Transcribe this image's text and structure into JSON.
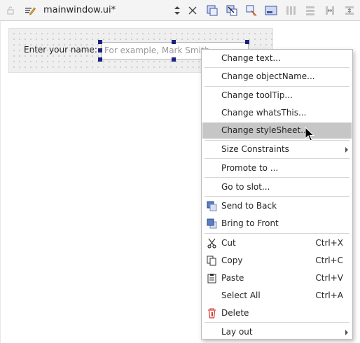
{
  "toolbar": {
    "document_title": "mainwindow.ui*",
    "icons": [
      "lock-icon",
      "edit-document-icon",
      "updown-icon",
      "close-icon",
      "edit-widgets-icon",
      "edit-signals-slots-icon",
      "edit-buddies-icon",
      "edit-tab-order-icon",
      "layout-horizontal-icon",
      "layout-vertical-icon",
      "layout-split-horizontal-icon",
      "layout-split-vertical-icon"
    ]
  },
  "form": {
    "label_text": "Enter your name:",
    "line_edit_placeholder": "For example, Mark Smith"
  },
  "context_menu": {
    "items": [
      {
        "label": "Change text..."
      },
      {
        "label": "Change objectName..."
      },
      {
        "label": "Change toolTip..."
      },
      {
        "label": "Change whatsThis..."
      },
      {
        "label": "Change styleSheet..."
      },
      {
        "label": "Size Constraints"
      },
      {
        "label": "Promote to ..."
      },
      {
        "label": "Go to slot..."
      },
      {
        "label": "Send to Back"
      },
      {
        "label": "Bring to Front"
      },
      {
        "label": "Cut",
        "shortcut": "Ctrl+X"
      },
      {
        "label": "Copy",
        "shortcut": "Ctrl+C"
      },
      {
        "label": "Paste",
        "shortcut": "Ctrl+V"
      },
      {
        "label": "Select All",
        "shortcut": "Ctrl+A"
      },
      {
        "label": "Delete"
      },
      {
        "label": "Lay out"
      }
    ],
    "highlighted_item": "Change styleSheet..."
  },
  "colors": {
    "accent_handle": "#1a237e",
    "highlight": "#c6c6c6",
    "delete_icon": "#d32f2f"
  }
}
